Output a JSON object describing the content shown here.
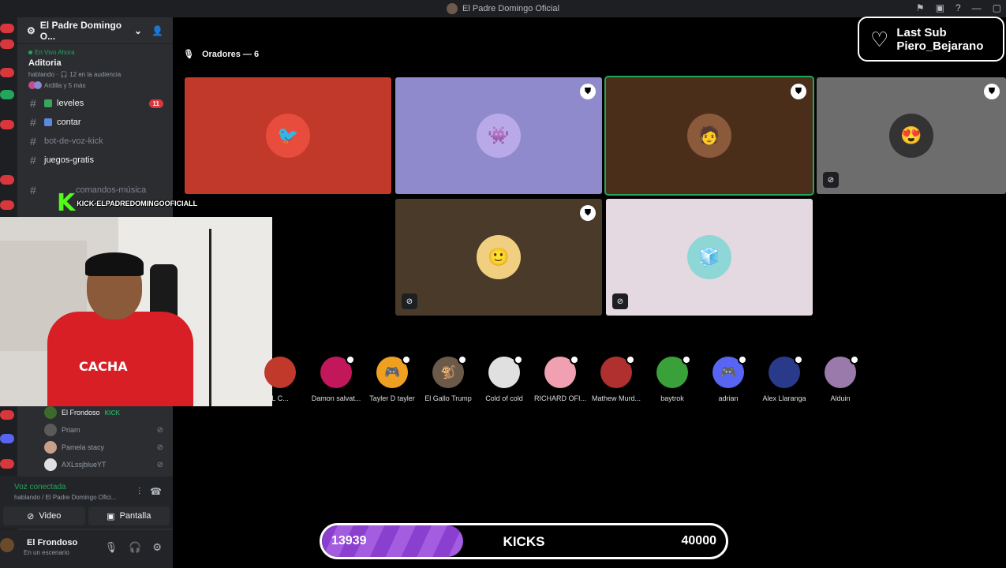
{
  "window": {
    "title": "El Padre Domingo Oficial"
  },
  "server": {
    "name": "El Padre Domingo O..."
  },
  "live": {
    "tag": "En Vivo Ahora",
    "stage_name": "Aditoria",
    "status": "hablando · 🎧 12 en la audiencia",
    "listeners": "Ardilla y 5 más"
  },
  "channels": [
    {
      "label": "leveles",
      "badge": "11"
    },
    {
      "label": "contar",
      "badge": ""
    },
    {
      "label": "bot-de-voz-kick",
      "badge": ""
    },
    {
      "label": "juegos-gratis",
      "badge": ""
    },
    {
      "label": "comandos-música",
      "badge": ""
    }
  ],
  "overlay": {
    "kick_text": "KICK-ELPADREDOMINGOOFICIALL"
  },
  "webcam": {
    "shirt_text": "CACHA"
  },
  "members": [
    {
      "name": "El Frondoso",
      "tag": "KICK",
      "color": "#3a6b2a"
    },
    {
      "name": "Priam",
      "tag": "",
      "color": "#5a5a5a"
    },
    {
      "name": "Pamela stacy",
      "tag": "",
      "color": "#c7a08a"
    },
    {
      "name": "AXLssjblueYT",
      "tag": "",
      "color": "#e0e0e0"
    }
  ],
  "voice": {
    "status": "Voz conectada",
    "channel": "hablando / El Padre Domingo Ofici..."
  },
  "buttons": {
    "video": "Video",
    "screen": "Pantalla"
  },
  "user": {
    "name": "El Frondoso",
    "status": "En un escenario"
  },
  "stage": {
    "speakers_label": "Oradores — 6"
  },
  "tiles": [
    {
      "bg": "#c0392b",
      "avatar_color": "#e74c3c",
      "glyph": "🐦",
      "corner": false,
      "mute": false
    },
    {
      "bg": "#8e8acb",
      "avatar_color": "#b9a9e8",
      "glyph": "👾",
      "corner": true,
      "mute": false
    },
    {
      "bg": "#4b2e1a",
      "avatar_color": "#8a5a3a",
      "glyph": "🧑",
      "corner": true,
      "mute": false,
      "outline": "#23a55a"
    },
    {
      "bg": "#6d6d6d",
      "avatar_color": "#333333",
      "glyph": "😍",
      "corner": true,
      "mute": true
    },
    {
      "bg": "#4a3a2a",
      "avatar_color": "#f0d080",
      "glyph": "🙂",
      "corner": true,
      "mute": true
    },
    {
      "bg": "#e5d9e1",
      "avatar_color": "#8fd6d6",
      "glyph": "🧊",
      "corner": false,
      "mute": true
    }
  ],
  "last_sub": {
    "line1": "Last Sub",
    "line2": "Piero_Bejarano"
  },
  "audience": [
    {
      "name": "L C...",
      "color": "#c0392b",
      "glyph": ""
    },
    {
      "name": "Damon salvat...",
      "color": "#c2185b",
      "glyph": ""
    },
    {
      "name": "Tayler D tayler",
      "color": "#f0a020",
      "glyph": "🎮"
    },
    {
      "name": "El Gallo Trump",
      "color": "#6b5a4a",
      "glyph": "🐒"
    },
    {
      "name": "Cold of cold",
      "color": "#e0e0e0",
      "glyph": ""
    },
    {
      "name": "RICHARD OFI...",
      "color": "#f0a0b0",
      "glyph": ""
    },
    {
      "name": "Mathew Murd...",
      "color": "#b03030",
      "glyph": ""
    },
    {
      "name": "baytrok",
      "color": "#3aa03a",
      "glyph": ""
    },
    {
      "name": "adrian",
      "color": "#5865f2",
      "glyph": "🎮"
    },
    {
      "name": "Alex Llaranga",
      "color": "#2a3a8a",
      "glyph": ""
    },
    {
      "name": "Alduin",
      "color": "#9a7aaa",
      "glyph": ""
    }
  ],
  "kicks": {
    "label": "KICKS",
    "current": "13939",
    "goal": "40000",
    "progress": 0.35
  }
}
